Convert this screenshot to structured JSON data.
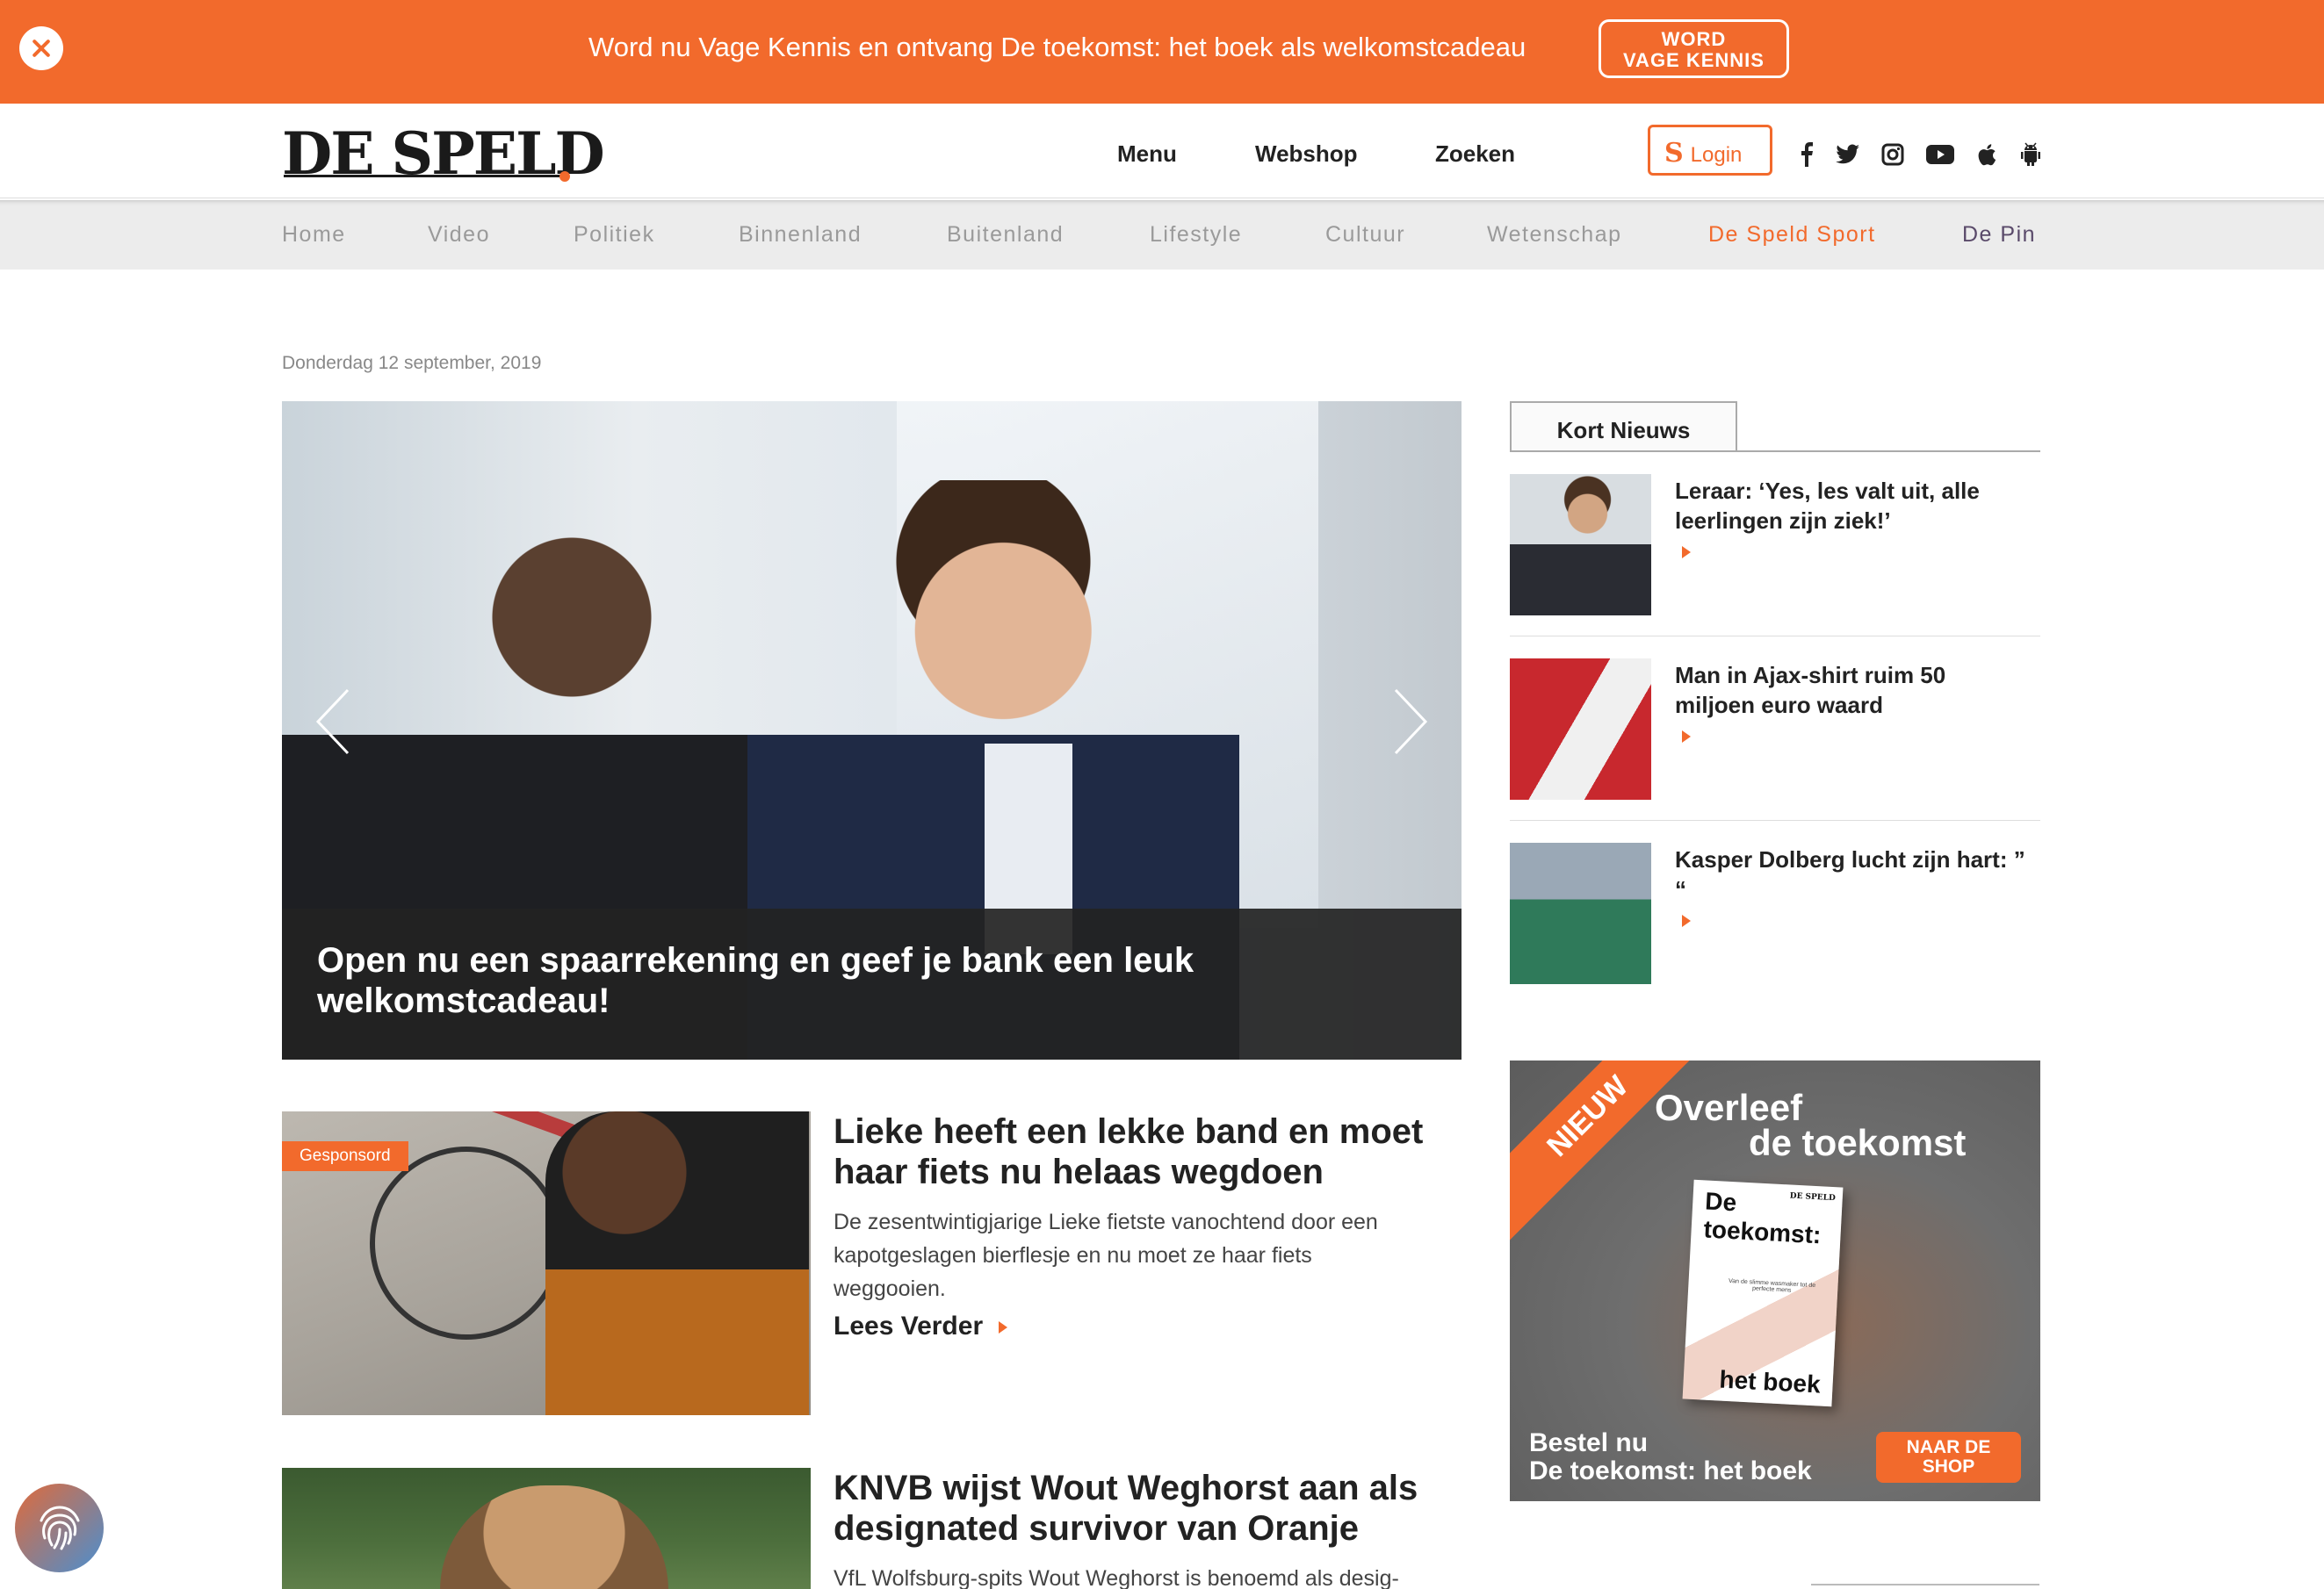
{
  "promo": {
    "text": "Word nu Vage Kennis en ontvang De toekomst: het boek als welkomstcadeau",
    "button_line1": "WORD",
    "button_line2": "VAGE KENNIS"
  },
  "header": {
    "logo": "DE SPELD",
    "nav": [
      "Menu",
      "Webshop",
      "Zoeken"
    ],
    "login_letter": "S",
    "login_label": "Login",
    "social_icons": [
      "facebook-icon",
      "twitter-icon",
      "instagram-icon",
      "youtube-icon",
      "apple-icon",
      "android-icon"
    ]
  },
  "categories": [
    "Home",
    "Video",
    "Politiek",
    "Binnenland",
    "Buitenland",
    "Lifestyle",
    "Cultuur",
    "Wetenschap",
    "De Speld Sport",
    "De Pin"
  ],
  "colors": {
    "accent": "#f26a2c",
    "sport": "#f26a2c",
    "pin": "#5a4a6a"
  },
  "date": "Donderdag 12 september, 2019",
  "hero": {
    "title_line1": "Open nu een spaarrekening en geef je bank een leuk",
    "title_line2": "welkomstcadeau!"
  },
  "articles": [
    {
      "badge": "Gesponsord",
      "title_line1": "Lieke heeft een lekke band en moet",
      "title_line2": "haar fiets nu helaas wegdoen",
      "text_line1": "De zesentwintigjarige Lieke fietste vanochtend door een",
      "text_line2": "kapotgeslagen bierflesje en nu moet ze haar fiets",
      "text_line3": "weggooien.",
      "read_more": "Lees Verder"
    },
    {
      "title_line1": "KNVB wijst Wout Weghorst aan als",
      "title_line2": "designated survivor van Oranje",
      "text_line1": "VfL Wolfsburg-spits Wout Weghorst is benoemd als desig-"
    }
  ],
  "sidebar": {
    "tab": "Kort Nieuws",
    "items": [
      {
        "title_line1": "Leraar: ‘Yes, les valt uit, alle",
        "title_line2": "leerlingen zijn ziek!’"
      },
      {
        "title_line1": "Man in Ajax-shirt ruim 50",
        "title_line2": "miljoen euro waard"
      },
      {
        "title_line1": "Kasper Dolberg lucht zijn hart: ”",
        "title_line2": "“"
      }
    ],
    "ad": {
      "ribbon": "NIEUW",
      "headline1": "Overleef",
      "headline2": "de toekomst",
      "book_title_top": "De toekomst:",
      "book_brand": "DE SPELD",
      "book_sub": "Van de slimme wasmaker tot de perfecte mens",
      "book_title_bottom": "het boek",
      "footer_line1": "Bestel nu",
      "footer_line2": "De toekomst: het boek",
      "button_line1": "NAAR DE",
      "button_line2": "SHOP"
    }
  }
}
